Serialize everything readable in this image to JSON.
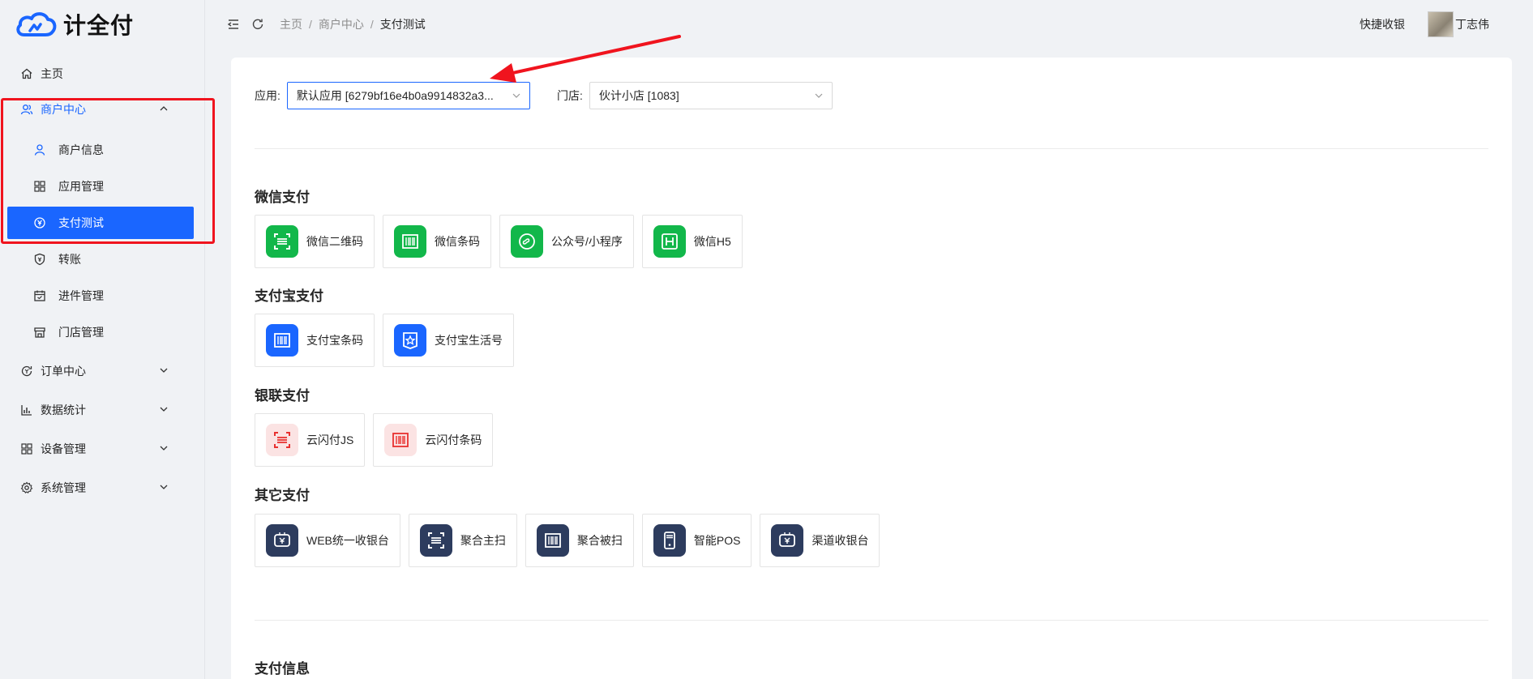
{
  "app": {
    "name": "计全付"
  },
  "sidebar": {
    "home": "主页",
    "merchant_center": "商户中心",
    "merchant_info": "商户信息",
    "app_manage": "应用管理",
    "pay_test": "支付测试",
    "transfer": "转账",
    "onboard_manage": "进件管理",
    "store_manage": "门店管理",
    "order_center": "订单中心",
    "data_stats": "数据统计",
    "device_manage": "设备管理",
    "system_manage": "系统管理"
  },
  "header": {
    "breadcrumb": [
      "主页",
      "商户中心",
      "支付测试"
    ],
    "breadcrumb_sep": "/",
    "quick_pay": "快捷收银",
    "user_name": "丁志伟"
  },
  "filters": {
    "app_label": "应用:",
    "app_value": "默认应用 [6279bf16e4b0a9914832a3...",
    "store_label": "门店:",
    "store_value": "伙计小店 [1083]"
  },
  "sections": {
    "wechat": {
      "title": "微信支付",
      "items": [
        "微信二维码",
        "微信条码",
        "公众号/小程序",
        "微信H5"
      ]
    },
    "alipay": {
      "title": "支付宝支付",
      "items": [
        "支付宝条码",
        "支付宝生活号"
      ]
    },
    "unionpay": {
      "title": "银联支付",
      "items": [
        "云闪付JS",
        "云闪付条码"
      ]
    },
    "other": {
      "title": "其它支付",
      "items": [
        "WEB统一收银台",
        "聚合主扫",
        "聚合被扫",
        "智能POS",
        "渠道收银台"
      ]
    },
    "pay_info": {
      "title": "支付信息"
    }
  },
  "colors": {
    "primary": "#1a66ff",
    "wechat_green": "#12b74a",
    "alipay_blue": "#1a66ff",
    "unionpay_red": "#e8302f",
    "other_navy": "#2d3c5e",
    "annotation_red": "#f0141e"
  }
}
